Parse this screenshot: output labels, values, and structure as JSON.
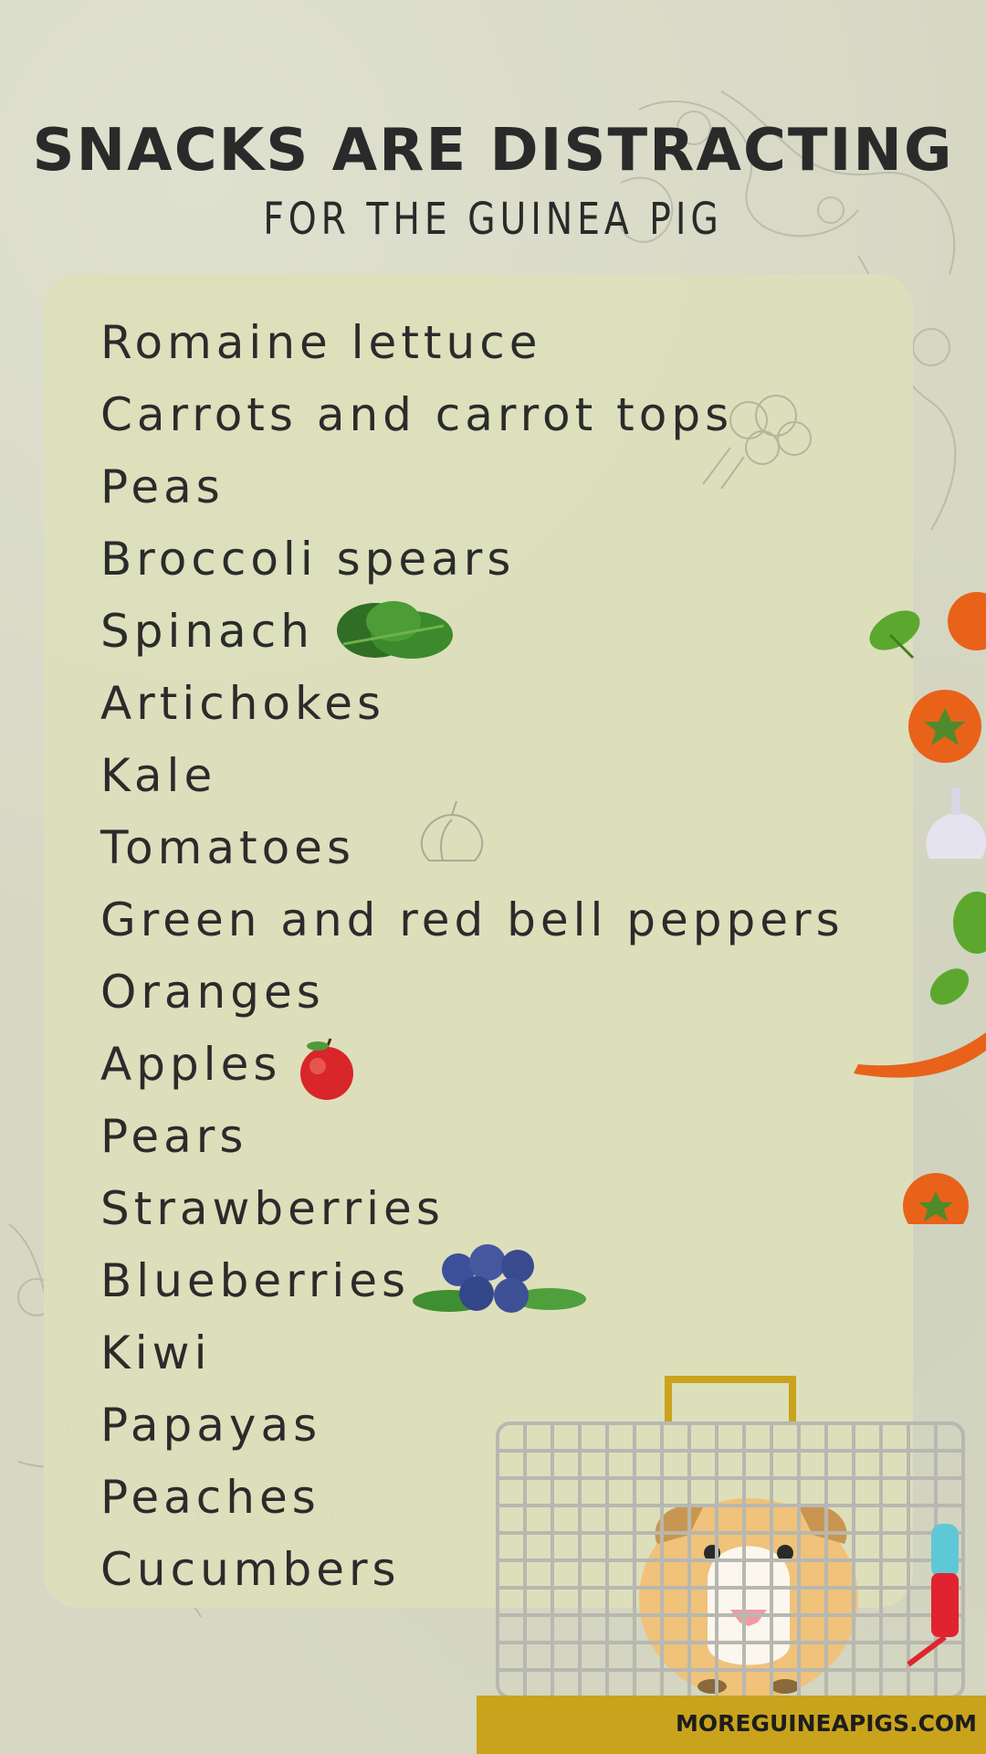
{
  "header": {
    "title": "SNACKS ARE DISTRACTING",
    "subtitle": "FOR THE GUINEA PIG"
  },
  "snacks": [
    "Romaine lettuce",
    "Carrots and carrot tops",
    "Peas",
    "Broccoli spears",
    "Spinach",
    "Artichokes",
    "Kale",
    "Tomatoes",
    "Green and red bell peppers",
    "Oranges",
    "Apples",
    "Pears",
    "Strawberries",
    "Blueberries",
    "Kiwi",
    "Papayas",
    "Peaches",
    "Cucumbers"
  ],
  "footer": {
    "website": "MOREGUINEAPIGS.COM"
  },
  "icons": [
    "spinach-icon",
    "apple-icon",
    "blueberries-icon",
    "guinea-pig-icon",
    "cage-icon",
    "water-bottle-icon",
    "orange-icon",
    "garlic-icon",
    "carrot-icon",
    "leaf-icon"
  ],
  "colors": {
    "background": "#d6d8c4",
    "panel": "#dde0bb",
    "text": "#2a2a2a",
    "accent": "#c9a31c",
    "orange": "#e8621a"
  }
}
